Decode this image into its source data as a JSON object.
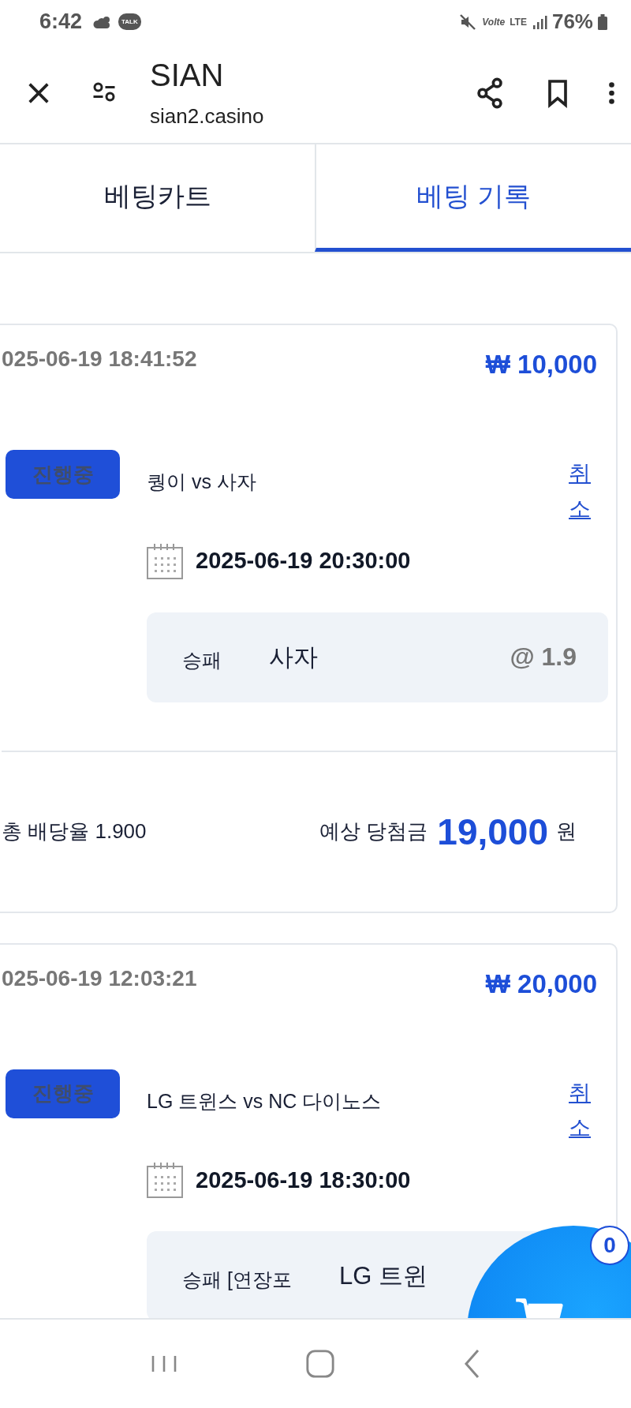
{
  "status_bar": {
    "time": "6:42",
    "talk": "TALK",
    "volte": "Volte",
    "network": "LTE",
    "battery": "76%"
  },
  "browser": {
    "title": "SIAN",
    "url": "sian2.casino"
  },
  "tabs": [
    {
      "label": "베팅카트",
      "selected": false
    },
    {
      "label": "베팅 기록",
      "selected": true
    }
  ],
  "bets": [
    {
      "placed_at": "025-06-19 18:41:52",
      "amount": "₩ 10,000",
      "status": "진행중",
      "match": "퀑이 vs 사자",
      "cancel": "취소",
      "start_time": "2025-06-19 20:30:00",
      "pick": {
        "market": "승패",
        "selection": "사자",
        "odds": "@ 1.9"
      },
      "total_odds": "총 배당율 1.900",
      "payout_label": "예상 당첨금",
      "payout": "19,000",
      "payout_unit": "원"
    },
    {
      "placed_at": "025-06-19 12:03:21",
      "amount": "₩ 20,000",
      "status": "진행중",
      "match": "LG 트윈스 vs NC 다이노스",
      "cancel": "취소",
      "start_time": "2025-06-19 18:30:00",
      "pick": {
        "market": "승패 [연장포",
        "selection": "LG 트윈"
      }
    }
  ],
  "cart": {
    "count": "0"
  }
}
